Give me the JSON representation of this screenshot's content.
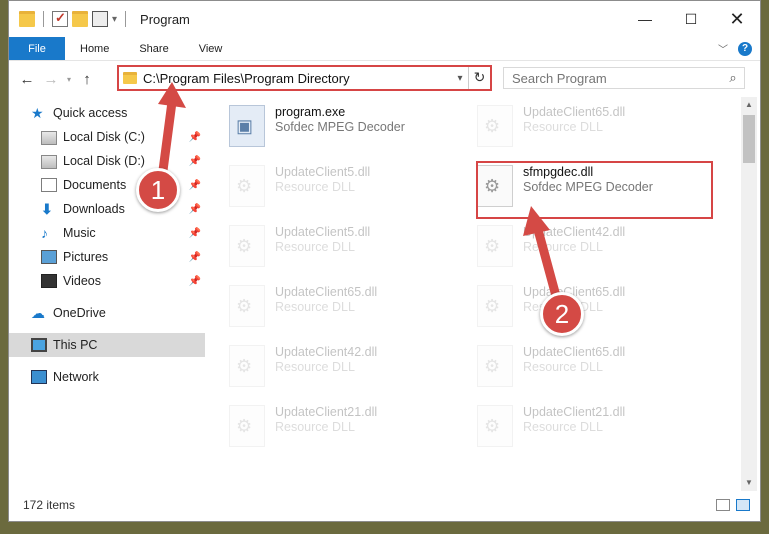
{
  "window": {
    "title": "Program",
    "buttons": {
      "minimize": "—",
      "maximize": "☐",
      "close": "✕"
    }
  },
  "ribbon": {
    "tabs": [
      "File",
      "Home",
      "Share",
      "View"
    ],
    "help": "?"
  },
  "nav": {
    "back": "←",
    "forward": "→",
    "up": "↑",
    "address": "C:\\Program Files\\Program Directory",
    "search_placeholder": "Search Program"
  },
  "sidebar": {
    "items": [
      {
        "label": "Quick access",
        "icon": "star-icon",
        "level": "top",
        "pinned": false
      },
      {
        "label": "Local Disk (C:)",
        "icon": "disk-icon",
        "level": "sub",
        "pinned": true
      },
      {
        "label": "Local Disk (D:)",
        "icon": "disk-icon",
        "level": "sub",
        "pinned": true
      },
      {
        "label": "Documents",
        "icon": "documents-icon",
        "level": "sub",
        "pinned": true
      },
      {
        "label": "Downloads",
        "icon": "downloads-icon",
        "level": "sub",
        "pinned": true
      },
      {
        "label": "Music",
        "icon": "music-icon",
        "level": "sub",
        "pinned": true
      },
      {
        "label": "Pictures",
        "icon": "pictures-icon",
        "level": "sub",
        "pinned": true
      },
      {
        "label": "Videos",
        "icon": "videos-icon",
        "level": "sub",
        "pinned": true
      },
      {
        "label": "OneDrive",
        "icon": "onedrive-icon",
        "level": "top",
        "pinned": false
      },
      {
        "label": "This PC",
        "icon": "this-pc-icon",
        "level": "top",
        "pinned": false,
        "selected": true
      },
      {
        "label": "Network",
        "icon": "network-icon",
        "level": "top",
        "pinned": false
      }
    ]
  },
  "files": [
    {
      "name": "program.exe",
      "desc": "Sofdec MPEG Decoder",
      "type": "exe",
      "faded": true
    },
    {
      "name": "UpdateClient65.dll",
      "desc": "Resource DLL",
      "type": "dll",
      "faded": true
    },
    {
      "name": "UpdateClient5.dll",
      "desc": "Resource DLL",
      "type": "dll",
      "faded": true
    },
    {
      "name": "sfmpgdec.dll",
      "desc": "Sofdec MPEG Decoder",
      "type": "dll",
      "faded": false
    },
    {
      "name": "UpdateClient5.dll",
      "desc": "Resource DLL",
      "type": "dll",
      "faded": true
    },
    {
      "name": "UpdateClient42.dll",
      "desc": "Resource DLL",
      "type": "dll",
      "faded": true
    },
    {
      "name": "UpdateClient65.dll",
      "desc": "Resource DLL",
      "type": "dll",
      "faded": true
    },
    {
      "name": "UpdateClient65.dll",
      "desc": "Resource DLL",
      "type": "dll",
      "faded": true
    },
    {
      "name": "UpdateClient42.dll",
      "desc": "Resource DLL",
      "type": "dll",
      "faded": true
    },
    {
      "name": "UpdateClient65.dll",
      "desc": "Resource DLL",
      "type": "dll",
      "faded": true
    },
    {
      "name": "UpdateClient21.dll",
      "desc": "Resource DLL",
      "type": "dll",
      "faded": true
    },
    {
      "name": "UpdateClient21.dll",
      "desc": "Resource DLL",
      "type": "dll",
      "faded": true
    }
  ],
  "status": {
    "count": "172 items"
  },
  "annotations": {
    "badge1": "1",
    "badge2": "2",
    "color": "#d44a45"
  }
}
